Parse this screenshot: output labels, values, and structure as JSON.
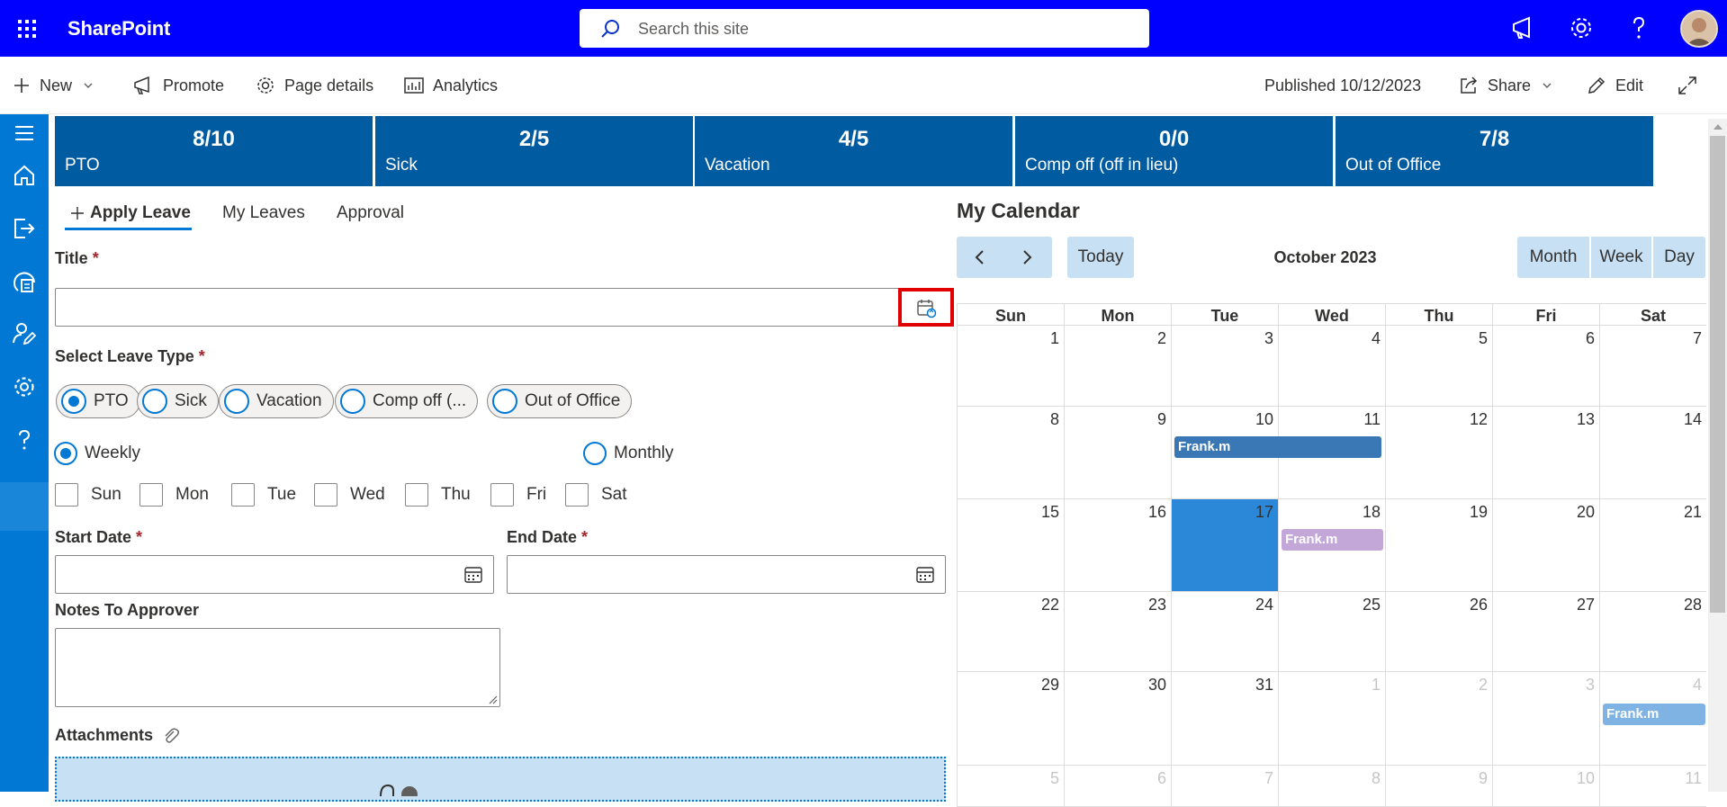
{
  "suitebar": {
    "brand": "SharePoint",
    "search_placeholder": "Search this site",
    "icons": [
      "waffle-icon",
      "megaphone-icon",
      "gear-icon",
      "help-icon",
      "avatar"
    ]
  },
  "commandbar": {
    "new_label": "New",
    "promote_label": "Promote",
    "page_details_label": "Page details",
    "analytics_label": "Analytics",
    "published_label": "Published 10/12/2023",
    "share_label": "Share",
    "edit_label": "Edit"
  },
  "rail": {
    "icons": [
      "hamburger-icon",
      "home-icon",
      "sign-out-icon",
      "document-settings-icon",
      "user-edit-icon",
      "gear-icon",
      "help-icon"
    ]
  },
  "tiles": [
    {
      "value": "8/10",
      "label": "PTO"
    },
    {
      "value": "2/5",
      "label": "Sick"
    },
    {
      "value": "4/5",
      "label": "Vacation"
    },
    {
      "value": "0/0",
      "label": "Comp off (off in lieu)"
    },
    {
      "value": "7/8",
      "label": "Out of Office"
    }
  ],
  "tabs": {
    "apply_leave": "Apply Leave",
    "my_leaves": "My Leaves",
    "approval": "Approval"
  },
  "form": {
    "title_label": "Title",
    "title_value": "",
    "leave_type_label": "Select Leave Type",
    "required_mark": "*",
    "leave_types": [
      "PTO",
      "Sick",
      "Vacation",
      "Comp off (...",
      "Out of Office"
    ],
    "selected_leave_type": "PTO",
    "recurrence_weekly": "Weekly",
    "recurrence_monthly": "Monthly",
    "days": [
      "Sun",
      "Mon",
      "Tue",
      "Wed",
      "Thu",
      "Fri",
      "Sat"
    ],
    "start_date_label": "Start Date",
    "end_date_label": "End Date",
    "notes_label": "Notes To Approver",
    "attachments_label": "Attachments"
  },
  "calendar": {
    "title": "My Calendar",
    "today_label": "Today",
    "month_label": "October 2023",
    "view_month": "Month",
    "view_week": "Week",
    "view_day": "Day",
    "day_headers": [
      "Sun",
      "Mon",
      "Tue",
      "Wed",
      "Thu",
      "Fri",
      "Sat"
    ],
    "weeks": [
      [
        "1",
        "2",
        "3",
        "4",
        "5",
        "6",
        "7"
      ],
      [
        "8",
        "9",
        "10",
        "11",
        "12",
        "13",
        "14"
      ],
      [
        "15",
        "16",
        "17",
        "18",
        "19",
        "20",
        "21"
      ],
      [
        "22",
        "23",
        "24",
        "25",
        "26",
        "27",
        "28"
      ],
      [
        "29",
        "30",
        "31",
        "1",
        "2",
        "3",
        "4"
      ],
      [
        "5",
        "6",
        "7",
        "8",
        "9",
        "10",
        "11"
      ]
    ],
    "today_date": "17",
    "events": [
      {
        "name": "Frank.m",
        "color": "#3a78b5"
      },
      {
        "name": "Frank.m",
        "color": "#c3a7d8"
      },
      {
        "name": "Frank.m",
        "color": "#7fb3e3"
      }
    ]
  },
  "colors": {
    "suitebar": "#0000ff",
    "rail": "#0078d4",
    "tile": "#005ba1",
    "today": "#2b88d8",
    "highlight_border": "#e00000"
  }
}
